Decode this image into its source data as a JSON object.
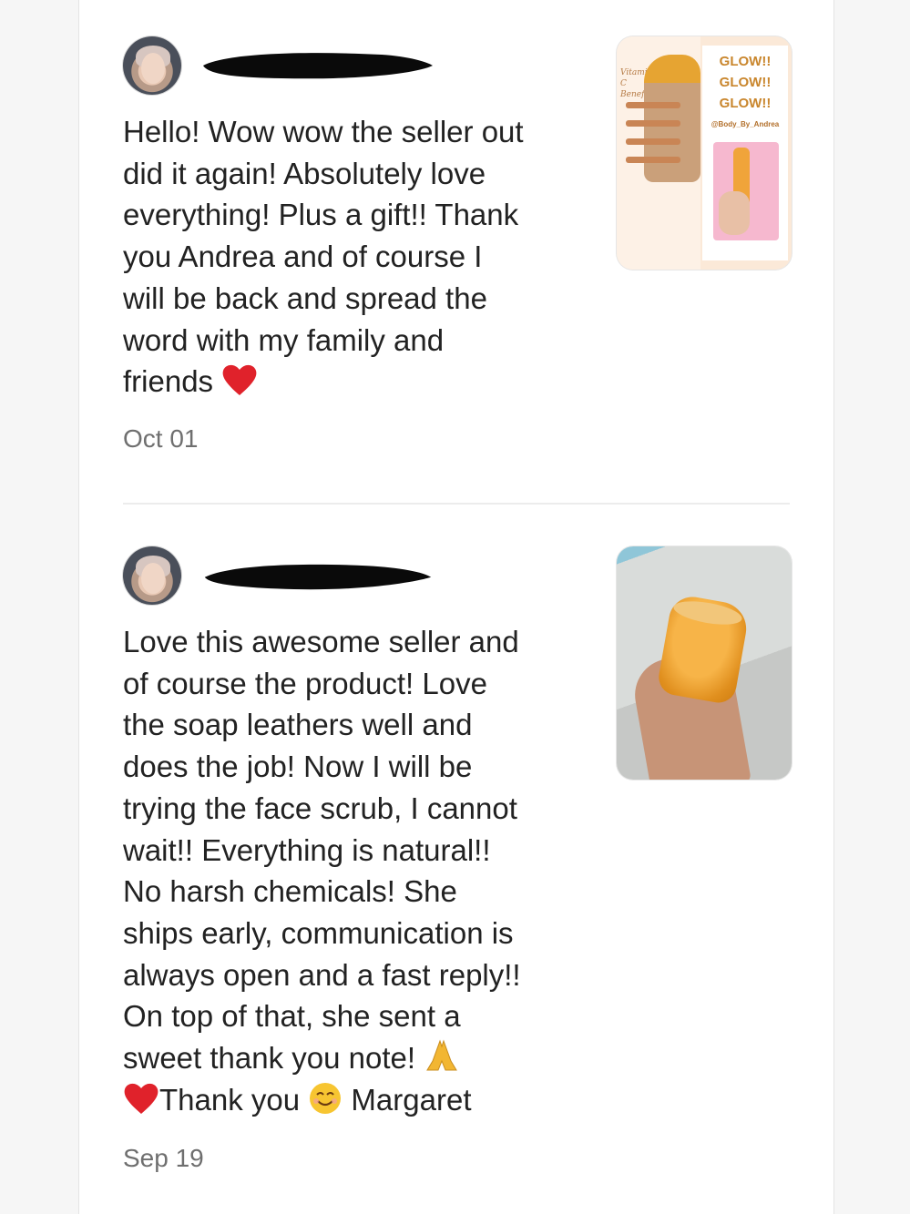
{
  "reviews": [
    {
      "text": "Hello! Wow wow the seller out\ndid it again! Absolutely love\neverything! Plus a gift!! Thank\nyou Andrea and of course I\nwill be back and spread the\nword with my family and\nfriends",
      "end_emoji": "heart-icon",
      "date": "Oct 01",
      "photo": {
        "script": "Vitamin C Benefits",
        "glow_lines": [
          "GLOW!!",
          "GLOW!!",
          "GLOW!!"
        ],
        "handle": "@Body_By_Andrea"
      }
    },
    {
      "text_part1": "Love this awesome seller and\nof course the product! Love\nthe soap leathers well and\ndoes the job! Now I will be\ntrying the face scrub, I cannot\nwait!! Everything is natural!!\nNo harsh chemicals! She\nships early, communication is\nalways open and a fast reply!!\nOn top of that, she sent a\nsweet thank you note! ",
      "emoji_after_note": "praying-hands-icon",
      "text_thank": "Thank you ",
      "emoji_after_thank": "smiling-face-icon",
      "text_name": " Margaret",
      "date": "Sep 19"
    }
  ],
  "colors": {
    "date": "#6f6f6f",
    "text": "#222222",
    "heart": "#e0222b"
  }
}
